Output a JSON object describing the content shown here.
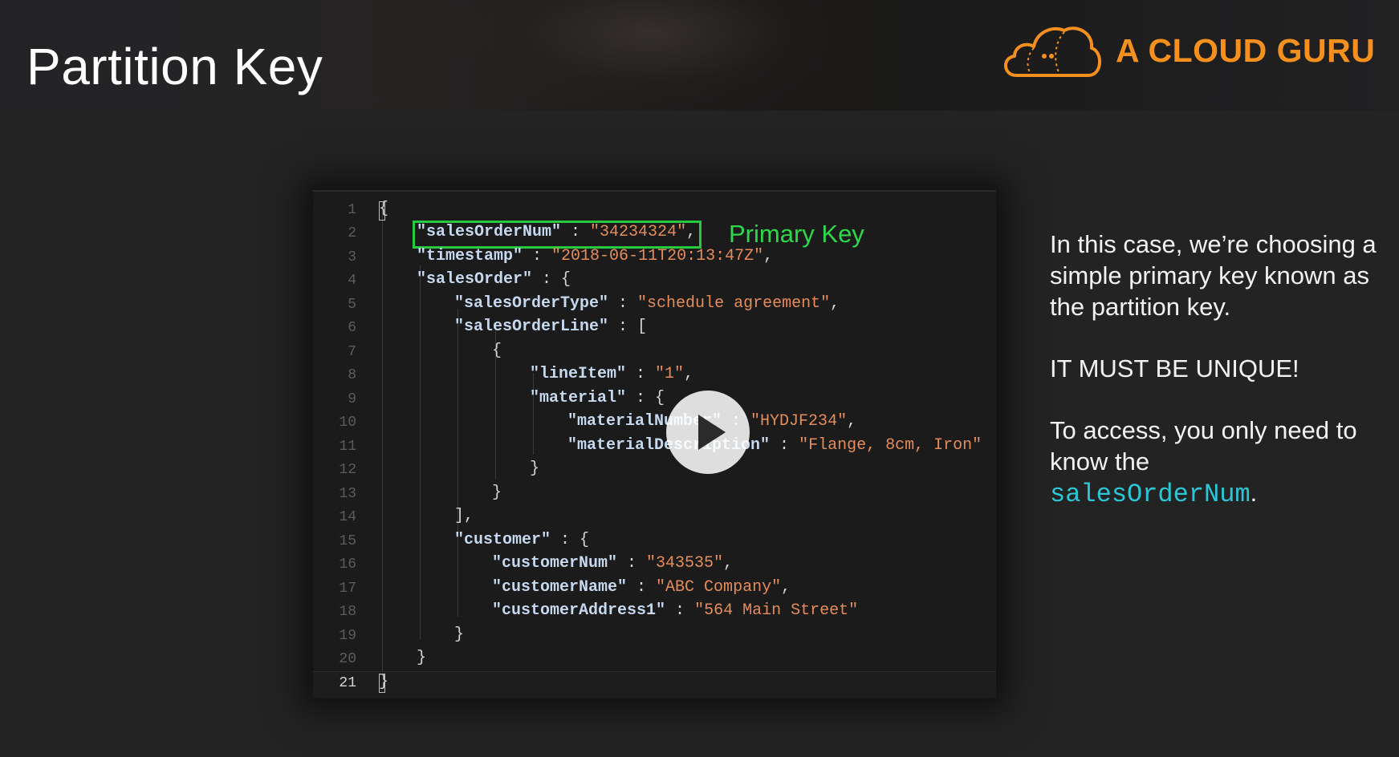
{
  "slide": {
    "title": "Partition Key",
    "brand": "A CLOUD GURU"
  },
  "code": {
    "line_numbers": [
      "1",
      "2",
      "3",
      "4",
      "5",
      "6",
      "7",
      "8",
      "9",
      "10",
      "11",
      "12",
      "13",
      "14",
      "15",
      "16",
      "17",
      "18",
      "19",
      "20",
      "21"
    ],
    "active_line": "21",
    "annotation": "Primary Key",
    "tokens": {
      "l1": "{",
      "l2_key": "\"salesOrderNum\"",
      "l2_sep": " : ",
      "l2_val": "\"34234324\"",
      "l2_end": ",",
      "l3_key": "\"timestamp\"",
      "l3_sep": " : ",
      "l3_val": "\"2018-06-11T20:13:47Z\"",
      "l3_end": ",",
      "l4_key": "\"salesOrder\"",
      "l4_sep": " : {",
      "l5_key": "\"salesOrderType\"",
      "l5_sep": " : ",
      "l5_val": "\"schedule agreement\"",
      "l5_end": ",",
      "l6_key": "\"salesOrderLine\"",
      "l6_sep": " : [",
      "l7": "{",
      "l8_key": "\"lineItem\"",
      "l8_sep": " : ",
      "l8_val": "\"1\"",
      "l8_end": ",",
      "l9_key": "\"material\"",
      "l9_sep": " : {",
      "l10_key": "\"materialNumber\"",
      "l10_sep": " : ",
      "l10_val": "\"HYDJF234\"",
      "l10_end": ",",
      "l11_key": "\"materialDescription\"",
      "l11_sep": " : ",
      "l11_val": "\"Flange, 8cm, Iron\"",
      "l12": "}",
      "l13": "}",
      "l14": "],",
      "l15_key": "\"customer\"",
      "l15_sep": " : {",
      "l16_key": "\"customerNum\"",
      "l16_sep": " : ",
      "l16_val": "\"343535\"",
      "l16_end": ",",
      "l17_key": "\"customerName\"",
      "l17_sep": " : ",
      "l17_val": "\"ABC Company\"",
      "l17_end": ",",
      "l18_key": "\"customerAddress1\"",
      "l18_sep": " : ",
      "l18_val": "\"564 Main Street\"",
      "l19": "}",
      "l20": "}",
      "l21": "}"
    }
  },
  "side": {
    "para1": "In this case, we’re choosing a simple primary key known as the partition key.",
    "para2": "IT MUST BE UNIQUE!",
    "para3_prefix": "To access, you only need to know the",
    "para3_key": "salesOrderNum",
    "para3_suffix": "."
  },
  "icons": {
    "logo": "cloud-logo-icon",
    "play": "play-icon"
  },
  "colors": {
    "brand": "#f5901e",
    "highlight_box": "#27c93f",
    "json_key": "#c6d8ee",
    "json_value": "#e48c5a",
    "key_name": "#2cc7d6"
  }
}
